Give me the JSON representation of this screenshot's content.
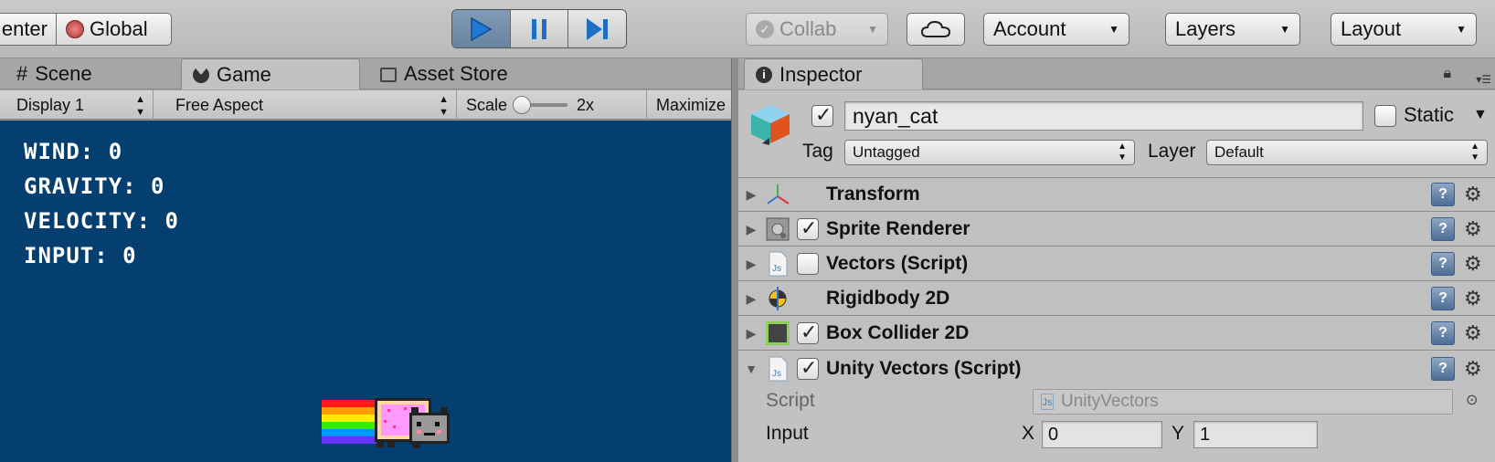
{
  "toolbar": {
    "pivot_label": "enter",
    "global_label": "Global",
    "collab_label": "Collab",
    "account_label": "Account",
    "layers_label": "Layers",
    "layout_label": "Layout"
  },
  "left_panel": {
    "tabs": [
      {
        "label": "Scene",
        "icon": "grid-icon"
      },
      {
        "label": "Game",
        "icon": "pacman-icon",
        "active": true
      },
      {
        "label": "Asset Store",
        "icon": "shopping-bag-icon"
      }
    ],
    "game_bar": {
      "display": "Display 1",
      "aspect": "Free Aspect",
      "scale_label": "Scale",
      "scale_value": "2x",
      "maximize_label": "Maximize"
    },
    "hud": {
      "wind": "WIND: 0",
      "gravity": "GRAVITY: 0",
      "velocity": "VELOCITY: 0",
      "input": "INPUT: 0"
    },
    "background_color": "#043f70"
  },
  "inspector": {
    "tab_label": "Inspector",
    "object_name": "nyan_cat",
    "active": true,
    "static_label": "Static",
    "static_checked": false,
    "tag_label": "Tag",
    "tag_value": "Untagged",
    "layer_label": "Layer",
    "layer_value": "Default",
    "components": [
      {
        "name": "Transform",
        "icon": "transform-axes-icon",
        "has_checkbox": false,
        "expanded": false
      },
      {
        "name": "Sprite Renderer",
        "icon": "sprite-renderer-icon",
        "has_checkbox": true,
        "checked": true,
        "expanded": false
      },
      {
        "name": "Vectors (Script)",
        "icon": "js-script-icon",
        "has_checkbox": true,
        "checked": false,
        "expanded": false
      },
      {
        "name": "Rigidbody 2D",
        "icon": "rigidbody-icon",
        "has_checkbox": false,
        "expanded": false
      },
      {
        "name": "Box Collider 2D",
        "icon": "box-collider-icon",
        "has_checkbox": true,
        "checked": true,
        "expanded": false
      },
      {
        "name": "Unity Vectors (Script)",
        "icon": "js-script-icon",
        "has_checkbox": true,
        "checked": true,
        "expanded": true
      }
    ],
    "script_label": "Script",
    "script_value": "UnityVectors",
    "input_label": "Input",
    "input_x_label": "X",
    "input_x": "0",
    "input_y_label": "Y",
    "input_y": "1"
  },
  "colors": {
    "play_active": "#6f8cab",
    "help_icon": "#5c7aa0"
  }
}
